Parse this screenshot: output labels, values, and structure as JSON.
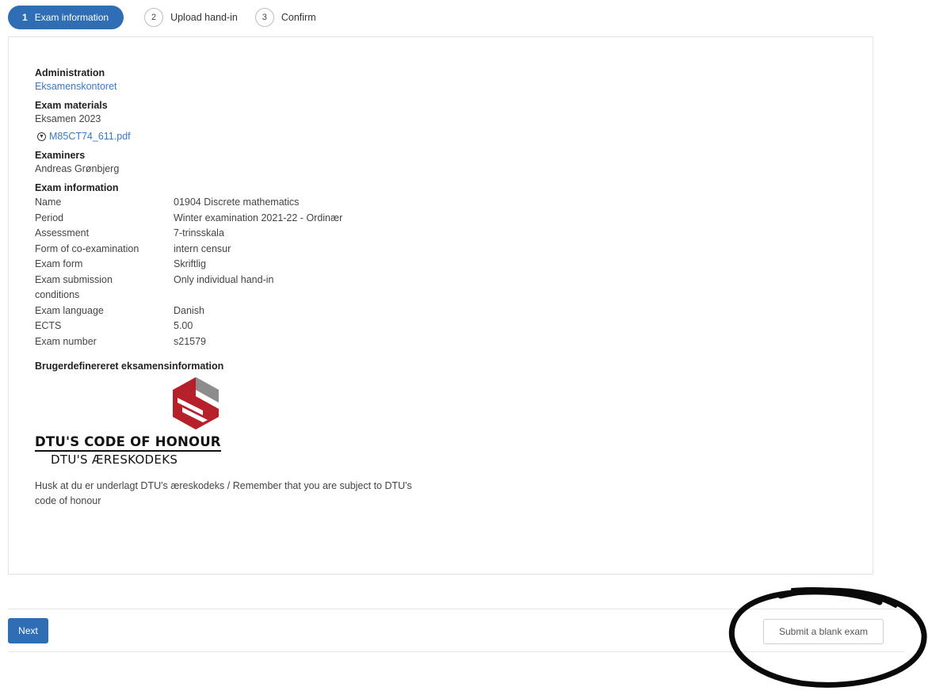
{
  "stepper": [
    {
      "num": "1",
      "label": "Exam information",
      "active": true
    },
    {
      "num": "2",
      "label": "Upload hand-in",
      "active": false
    },
    {
      "num": "3",
      "label": "Confirm",
      "active": false
    }
  ],
  "administration": {
    "heading": "Administration",
    "value": "Eksamenskontoret"
  },
  "materials": {
    "heading": "Exam materials",
    "value": "Eksamen 2023",
    "file": "M85CT74_611.pdf"
  },
  "examiners": {
    "heading": "Examiners",
    "value": "Andreas Grønbjerg"
  },
  "exam_info": {
    "heading": "Exam information",
    "rows": [
      {
        "key": "Name",
        "value": "01904 Discrete mathematics"
      },
      {
        "key": "Period",
        "value": "Winter examination 2021-22 - Ordinær"
      },
      {
        "key": "Assessment",
        "value": "7-trinsskala"
      },
      {
        "key": "Form of co-examination",
        "value": "intern censur"
      },
      {
        "key": "Exam form",
        "value": "Skriftlig"
      },
      {
        "key": "Exam submission conditions",
        "value": "Only individual hand-in"
      },
      {
        "key": "Exam language",
        "value": "Danish"
      },
      {
        "key": "ECTS",
        "value": "5.00"
      },
      {
        "key": "Exam number",
        "value": "s21579"
      }
    ]
  },
  "custom": {
    "heading": "Brugerdefinereret eksamensinformation",
    "logo_line1": "DTU'S CODE OF HONOUR",
    "logo_line2": "DTU'S ÆRESKODEKS",
    "reminder": "Husk at du er underlagt DTU's æreskodeks / Remember that you are subject to DTU's code of honour"
  },
  "footer": {
    "next_label": "Next",
    "blank_label": "Submit a blank exam"
  },
  "colors": {
    "primary": "#2f6db5",
    "link": "#3a79c0",
    "logo_red": "#b5202a",
    "logo_grey": "#8c8c8c"
  }
}
